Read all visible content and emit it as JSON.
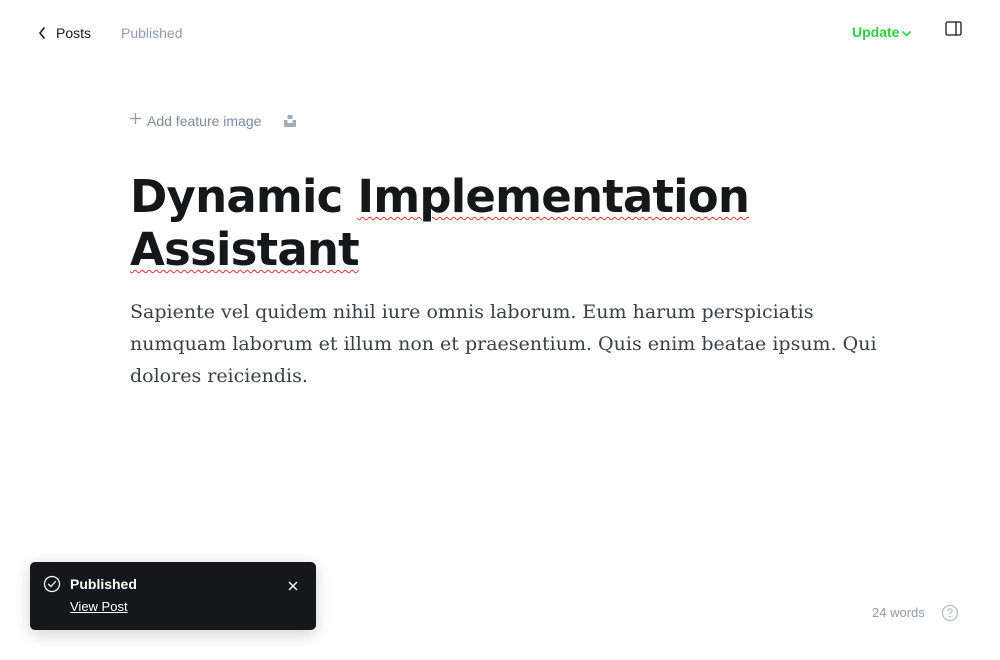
{
  "header": {
    "back_label": "Posts",
    "status": "Published",
    "update_label": "Update"
  },
  "feature": {
    "add_label": "Add feature image"
  },
  "post": {
    "title_words": [
      "Dynamic",
      "Implementation",
      "Assistant"
    ],
    "body": "Sapiente vel quidem nihil iure omnis laborum. Eum harum perspiciatis numquam laborum et illum non et praesentium. Quis enim beatae ipsum. Qui dolores reiciendis."
  },
  "toast": {
    "title": "Published",
    "link_label": "View Post"
  },
  "footer": {
    "word_count": "24 words"
  },
  "colors": {
    "accent_green": "#30cf43",
    "toast_bg": "#15171a",
    "spellcheck_red": "#e0362b"
  },
  "icons": {
    "back": "chevron-left-icon",
    "update_dropdown": "chevron-down-icon",
    "sidebar": "sidebar-panel-icon",
    "add": "plus-icon",
    "unsplash": "unsplash-icon",
    "toast_status": "check-circle-icon",
    "toast_close": "close-icon",
    "help": "question-circle-icon"
  }
}
